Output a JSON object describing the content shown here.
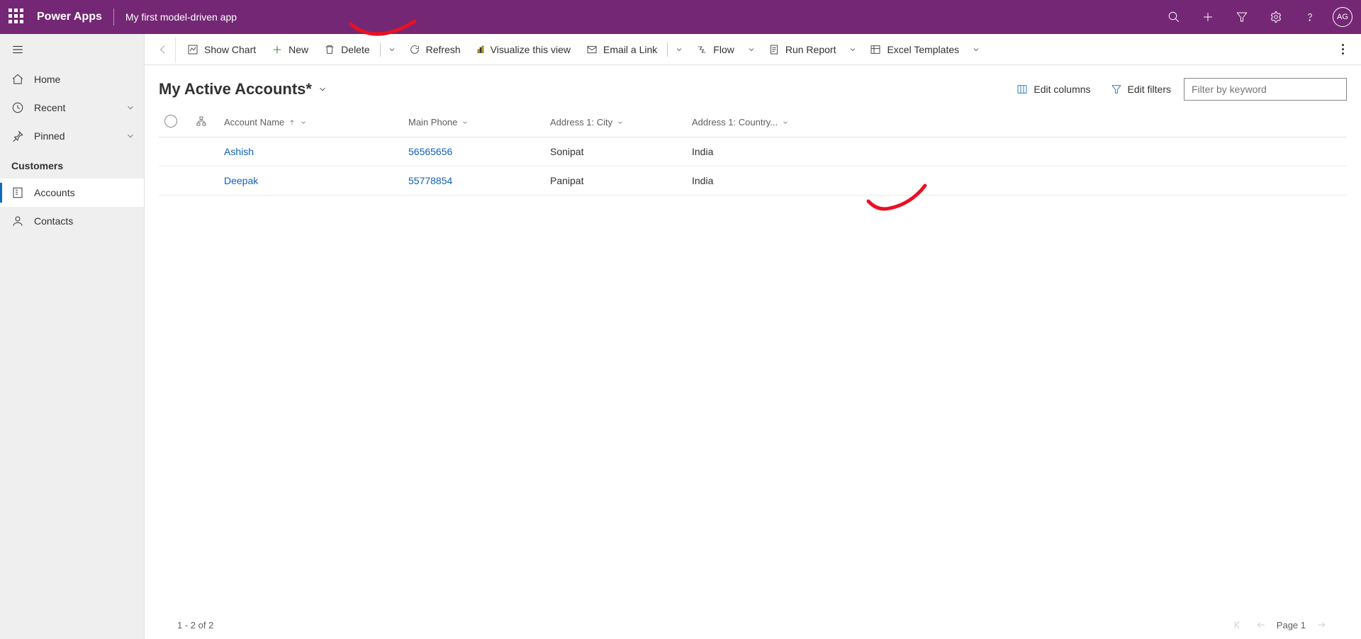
{
  "topbar": {
    "brand": "Power Apps",
    "app_name": "My first model-driven app",
    "avatar_initials": "AG"
  },
  "sidebar": {
    "home": "Home",
    "recent": "Recent",
    "pinned": "Pinned",
    "section": "Customers",
    "accounts": "Accounts",
    "contacts": "Contacts"
  },
  "commandbar": {
    "show_chart": "Show Chart",
    "new": "New",
    "delete": "Delete",
    "refresh": "Refresh",
    "visualize": "Visualize this view",
    "email": "Email a Link",
    "flow": "Flow",
    "run_report": "Run Report",
    "excel_templates": "Excel Templates"
  },
  "view": {
    "title": "My Active Accounts*",
    "edit_columns": "Edit columns",
    "edit_filters": "Edit filters",
    "filter_placeholder": "Filter by keyword"
  },
  "columns": {
    "name": "Account Name",
    "phone": "Main Phone",
    "city": "Address 1: City",
    "country": "Address 1: Country..."
  },
  "rows": [
    {
      "name": "Ashish",
      "phone": "56565656",
      "city": "Sonipat",
      "country": "India"
    },
    {
      "name": "Deepak",
      "phone": "55778854",
      "city": "Panipat",
      "country": "India"
    }
  ],
  "footer": {
    "range": "1 - 2 of 2",
    "page_label": "Page 1"
  }
}
